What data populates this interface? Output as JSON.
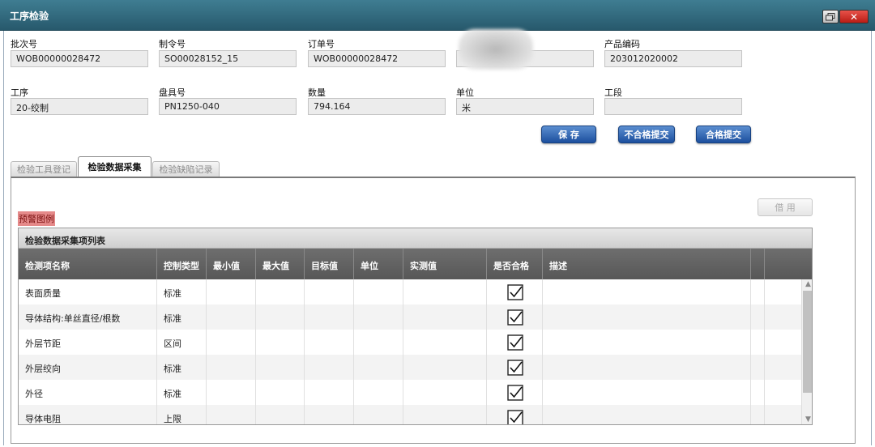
{
  "window": {
    "title": "工序检验",
    "restore_icon": "restore-icon",
    "close_label": "✕"
  },
  "fields": [
    {
      "label": "批次号",
      "value": "WOB00000028472"
    },
    {
      "label": "制令号",
      "value": "SO00028152_15"
    },
    {
      "label": "订单号",
      "value": "WOB00000028472"
    },
    {
      "label": "",
      "value": ""
    },
    {
      "label": "产品编码",
      "value": "203012020002"
    },
    {
      "label": "工序",
      "value": "20-绞制"
    },
    {
      "label": "盘具号",
      "value": "PN1250-040"
    },
    {
      "label": "数量",
      "value": "794.164"
    },
    {
      "label": "单位",
      "value": "米"
    },
    {
      "label": "工段",
      "value": ""
    }
  ],
  "actions": {
    "save": "保 存",
    "reject_submit": "不合格提交",
    "accept_submit": "合格提交"
  },
  "tabs": [
    "检验工具登记",
    "检验数据采集",
    "检验缺陷记录"
  ],
  "panel": {
    "legend": "预警图例",
    "disabled_button": "借 用"
  },
  "grid": {
    "title": "检验数据采集项列表",
    "columns": [
      "检测项名称",
      "控制类型",
      "最小值",
      "最大值",
      "目标值",
      "单位",
      "实测值",
      "是否合格",
      "描述"
    ],
    "rows": [
      {
        "name": "表面质量",
        "type": "标准",
        "pass": true
      },
      {
        "name": "导体结构:单丝直径/根数",
        "type": "标准",
        "pass": true
      },
      {
        "name": "外层节距",
        "type": "区间",
        "pass": true
      },
      {
        "name": "外层绞向",
        "type": "标准",
        "pass": true
      },
      {
        "name": "外径",
        "type": "标准",
        "pass": true
      },
      {
        "name": "导体电阻",
        "type": "上限",
        "pass": true
      }
    ]
  },
  "colors": {
    "titlebar": "#2f6a7f",
    "button": "#2a5fae",
    "grid_header": "#626262",
    "legend": "#e58a8a"
  }
}
